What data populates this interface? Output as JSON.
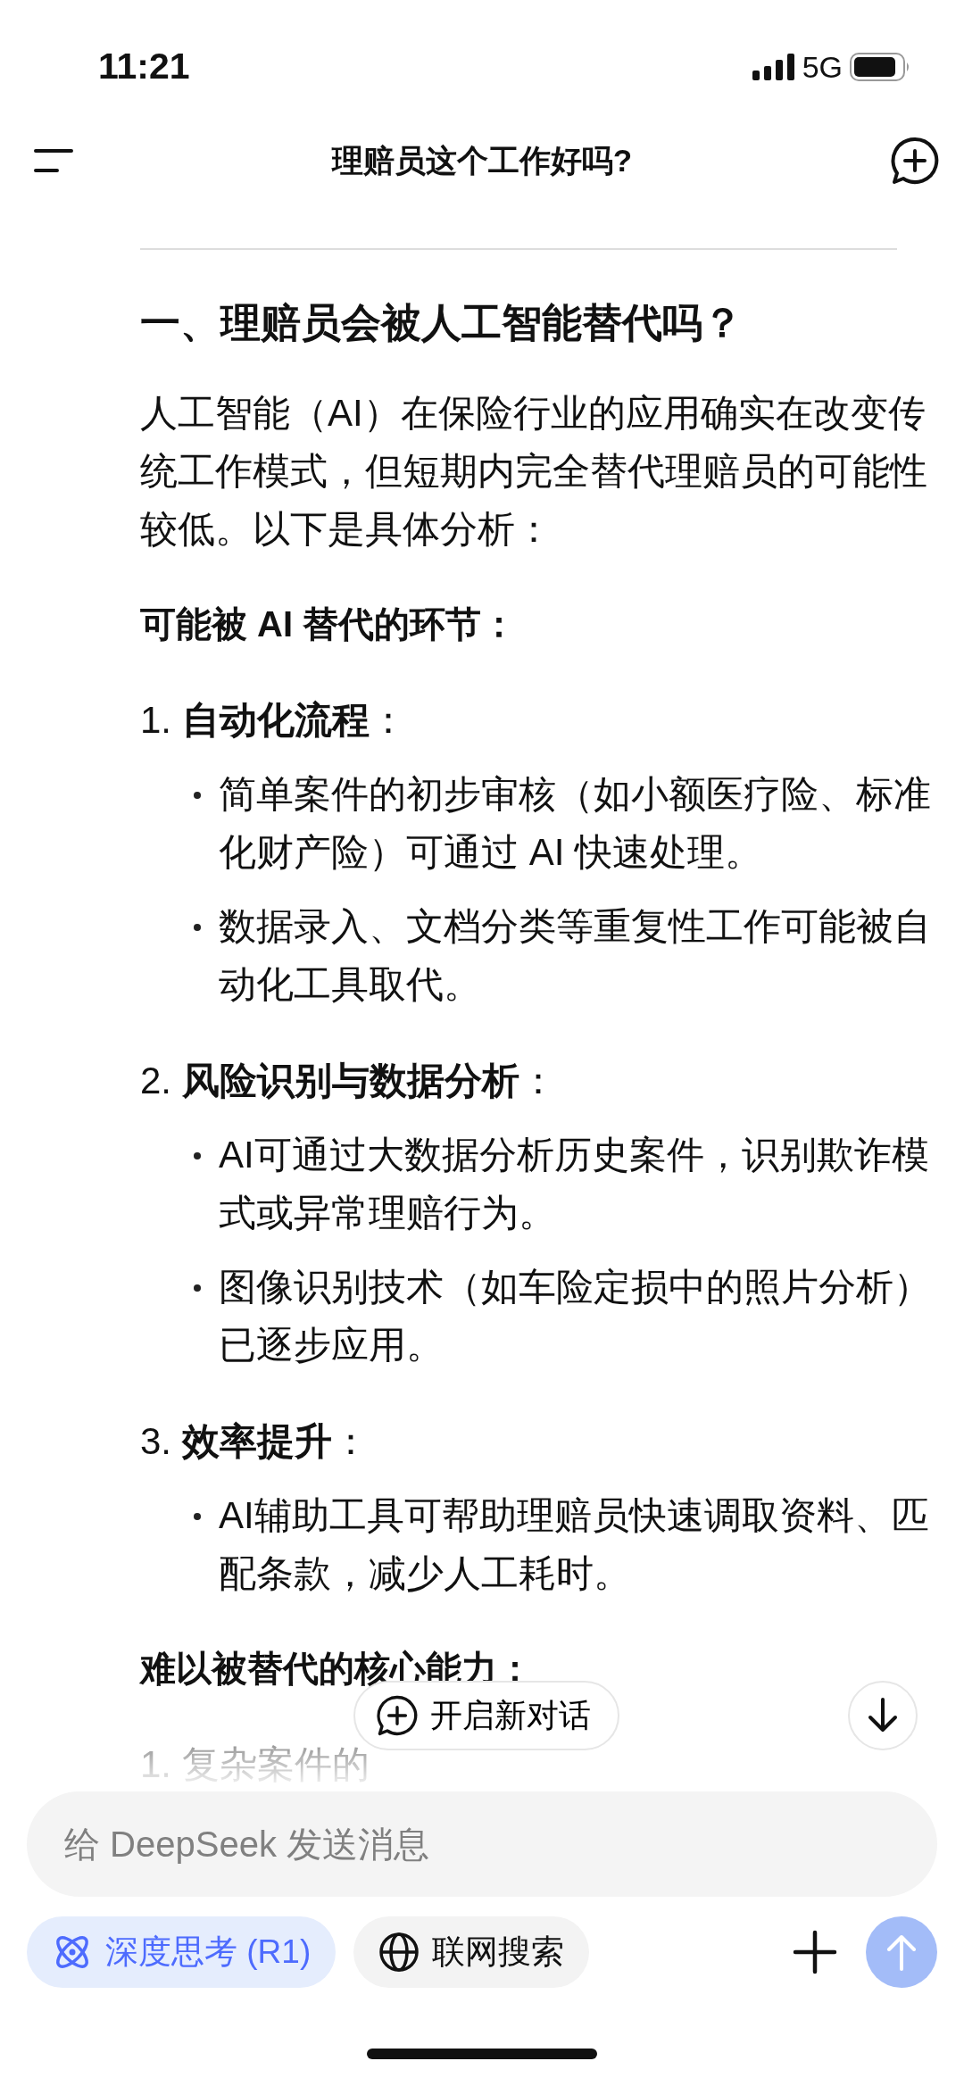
{
  "status_bar": {
    "time": "11:21",
    "network": "5G"
  },
  "header": {
    "title": "理赔员这个工作好吗?"
  },
  "article": {
    "heading": "一、理赔员会被人工智能替代吗？",
    "intro": "人工智能（AI）在保险行业的应用确实在改变传统工作模式，但短期内完全替代理赔员的可能性较低。以下是具体分析：",
    "sections": [
      {
        "title": "可能被 AI 替代的环节：",
        "items": [
          {
            "label": "1. **自动化流程**：",
            "bullets": [
              "简单案件的初步审核（如小额医疗险、标准化财产险）可通过 AI 快速处理。",
              "数据录入、文档分类等重复性工作可能被自动化工具取代。"
            ]
          },
          {
            "label": "2. **风险识别与数据分析**：",
            "bullets": [
              "AI可通过大数据分析历史案件，识别欺诈模式或异常理赔行为。",
              "图像识别技术（如车险定损中的照片分析）已逐步应用。"
            ]
          },
          {
            "label": "3. **效率提升**：",
            "bullets": [
              "AI辅助工具可帮助理赔员快速调取资料、匹配条款，减少人工耗时。"
            ]
          }
        ]
      },
      {
        "title": "难以被替代的核心能力：",
        "items": [
          {
            "label": "1. 复杂案件的"
          }
        ]
      }
    ]
  },
  "new_chat_button": "开启新对话",
  "composer": {
    "placeholder": "给 DeepSeek 发送消息",
    "toggles": [
      {
        "kind": "atom",
        "label": "深度思考 (R1)",
        "selected": true
      },
      {
        "kind": "globe",
        "label": "联网搜索",
        "selected": false
      }
    ],
    "send_disabled": true
  }
}
